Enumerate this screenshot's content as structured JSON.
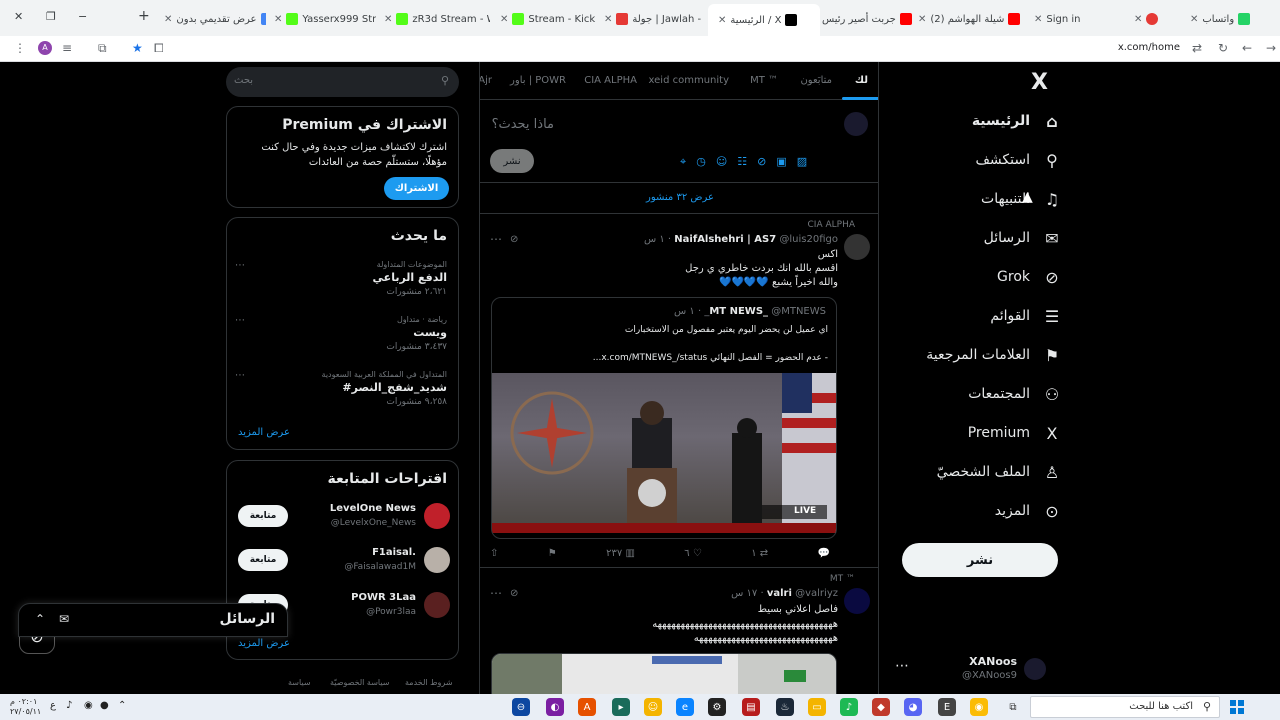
{
  "browser": {
    "tabs": [
      {
        "label": "واتساب",
        "color": "#25d366"
      },
      {
        "label": "",
        "color": "#e53935"
      },
      {
        "label": "Sign in",
        "color": "#ffffff"
      },
      {
        "label": "(2) شيلة الهواشم",
        "color": "#ff0000"
      },
      {
        "label": "جربت أصير رئيس",
        "color": "#ff0000"
      },
      {
        "label": "الرئيسية / X",
        "color": "#000000"
      },
      {
        "label": "جولة | Jawlah - ماء",
        "color": "#e53935"
      },
      {
        "label": "Stream - Kick Das",
        "color": "#53fc18"
      },
      {
        "label": "zR3d Stream - Wa",
        "color": "#53fc18"
      },
      {
        "label": "Yasserx999 Strea",
        "color": "#53fc18"
      },
      {
        "label": "عرض تقديمي بدون",
        "color": "#4285f4"
      }
    ],
    "url": "x.com/home",
    "profile_letter": "A",
    "win_controls": {
      "close": "✕",
      "restore": "❐",
      "minimize": "−",
      "newtab": "+"
    }
  },
  "nav": {
    "logo": "X",
    "items": [
      {
        "label": "الرئيسية",
        "icon": "home-icon",
        "glyph": "⌂"
      },
      {
        "label": "استكشف",
        "icon": "search-icon",
        "glyph": "⚲"
      },
      {
        "label": "التنبيهات",
        "icon": "bell-icon",
        "glyph": "♫"
      },
      {
        "label": "الرسائل",
        "icon": "mail-icon",
        "glyph": "✉"
      },
      {
        "label": "Grok",
        "icon": "grok-icon",
        "glyph": "⊘"
      },
      {
        "label": "القوائم",
        "icon": "list-icon",
        "glyph": "☰"
      },
      {
        "label": "العلامات المرجعية",
        "icon": "bookmark-icon",
        "glyph": "⚑"
      },
      {
        "label": "المجتمعات",
        "icon": "communities-icon",
        "glyph": "⚇"
      },
      {
        "label": "Premium",
        "icon": "x-premium-icon",
        "glyph": "X"
      },
      {
        "label": "الملف الشخصيّ",
        "icon": "profile-icon",
        "glyph": "♙"
      },
      {
        "label": "المزيد",
        "icon": "more-icon",
        "glyph": "⊙"
      }
    ],
    "post_button": "نشر",
    "account": {
      "name": "XANoos",
      "handle": "@XANoos9"
    }
  },
  "main": {
    "tabs": [
      "لك",
      "متابَعون",
      "MT ™",
      "xeid community",
      "CIA ALPHA",
      "باور | POWR",
      "Ajr"
    ],
    "composer": {
      "placeholder": "ماذا يحدث؟",
      "post_label": "نشر"
    },
    "show_more": "عرض ٣٢ منشور",
    "post1": {
      "context": "CIA ALPHA",
      "author": "NaifAlshehri | AS7",
      "handle": "@luis20figo",
      "time": "١ س",
      "lines": [
        "اكس",
        "اقسم بالله انك بردت خاطري ي رجل",
        "والله اخيراً يشبع 💙💙💙💙"
      ],
      "quote": {
        "author": "MT NEWS_",
        "handle": "@MTNEWS_",
        "time": "١ س",
        "line1": "اي عميل لن يحضر اليوم يعتبر مفصول من الاستخبارات",
        "line2": "- عدم الحضور = الفصل النهائي  x.com/MTNEWS_/status...",
        "badge": "LIVE"
      },
      "actions": {
        "reply": "",
        "retweet": "١",
        "like": "٦",
        "views": "٢٣٧"
      }
    },
    "post2": {
      "context": "MT ™",
      "author": "valri",
      "handle": "@valriyz",
      "time": "١٧ س",
      "line1": "فاصل اعلاني بسيط",
      "line2": "هههههههههههههههههههههههههههههههههههههههه",
      "line3": "ههههههههههههههههههههههههههههههه"
    }
  },
  "side": {
    "search_placeholder": "بحث",
    "premium": {
      "title": "Premium الاشتراك في",
      "text": "اشترك لاكتشاف ميزات جديدة وفي حال كنت مؤهلًا، ستستلّم حصة من العائدات",
      "button": "الاشتراك"
    },
    "trends": {
      "title": "ما يحدث",
      "items": [
        {
          "category": "الموضوعات المتداولة",
          "title": "الدفع الرباعي",
          "count": "٢،٦٢١ منشورات"
        },
        {
          "category": "رياضة · متداول",
          "title": "ويست",
          "count": "٣،٤٣٧ منشورات"
        },
        {
          "category": "المتداول في المملكة العربية السعودية",
          "title": "#شديد_شفج_النصر",
          "count": "٩،٢٥٨ منشورات"
        }
      ],
      "more": "عرض المزيد"
    },
    "follow": {
      "title": "اقتراحات المتابعة",
      "items": [
        {
          "name": "LevelOne News",
          "handle": "@LevelxOne_News",
          "button": "متابعة"
        },
        {
          "name": "F1aisal.",
          "handle": "@Faisalawad1M",
          "button": "متابعة"
        },
        {
          "name": "POWR 3Laa",
          "handle": "@Powr3laa",
          "button": "متابعة"
        }
      ],
      "more": "عرض المزيد"
    },
    "footer": [
      "شروط الخدمة",
      "سياسة الخصوصيّة",
      "سياسة"
    ]
  },
  "messages_bar": {
    "title": "الرسائل"
  },
  "taskbar": {
    "search_placeholder": "اكتب هنا للبحث",
    "time": "٠٢:٠١ م",
    "date": "٢٧/٠٥/١١",
    "lang": "ع"
  }
}
